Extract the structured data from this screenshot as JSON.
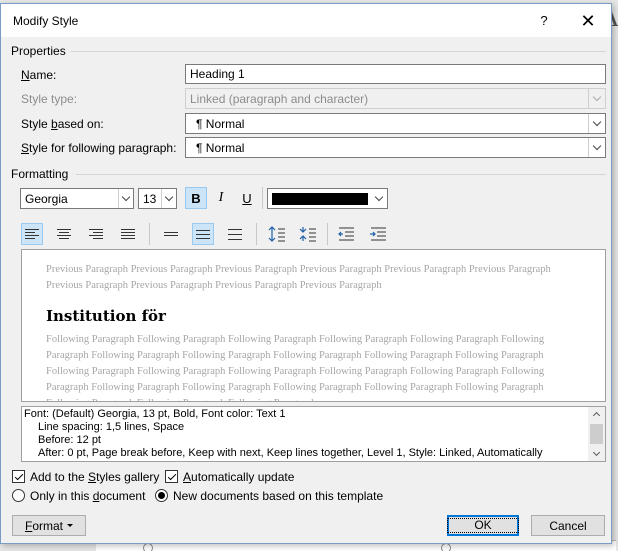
{
  "background": {
    "doc_letter": "A"
  },
  "dialog": {
    "title": "Modify Style",
    "help": "?",
    "close": "✕"
  },
  "properties": {
    "section": "Properties",
    "name_label_pre": "",
    "name_label_u": "N",
    "name_label_post": "ame:",
    "name_value": "Heading 1",
    "style_type_label": "Style type:",
    "style_type_value": "Linked (paragraph and character)",
    "based_on_label_pre": "Style ",
    "based_on_label_u": "b",
    "based_on_label_post": "ased on:",
    "based_on_value": "¶  Normal",
    "following_label_pre": "",
    "following_label_u": "S",
    "following_label_post": "tyle for following paragraph:",
    "following_value": "¶  Normal"
  },
  "formatting": {
    "section": "Formatting",
    "font": "Georgia",
    "size": "13",
    "bold": "B",
    "italic": "I",
    "underline": "U",
    "font_color": "#000000"
  },
  "preview": {
    "previous": "Previous Paragraph Previous Paragraph Previous Paragraph Previous Paragraph Previous Paragraph Previous Paragraph Previous Paragraph Previous Paragraph Previous Paragraph Previous Paragraph",
    "heading": "Institution för",
    "following": "Following Paragraph Following Paragraph Following Paragraph Following Paragraph Following Paragraph Following Paragraph Following Paragraph Following Paragraph Following Paragraph Following Paragraph Following Paragraph Following Paragraph Following Paragraph Following Paragraph Following Paragraph Following Paragraph Following Paragraph Following Paragraph Following Paragraph Following Paragraph Following Paragraph Following Paragraph Following Paragraph Following Paragraph Following Paragraph"
  },
  "description": {
    "line1": "Font: (Default) Georgia, 13 pt, Bold, Font color: Text 1",
    "line2": "Line spacing:  1,5 lines, Space",
    "line3": "Before:  12 pt",
    "line4": "After:  0 pt, Page break before, Keep with next, Keep lines together, Level 1, Style: Linked, Automatically"
  },
  "options": {
    "add_gallery_pre": "Add to the ",
    "add_gallery_u": "S",
    "add_gallery_post": "tyles gallery",
    "add_gallery_checked": true,
    "auto_update_u": "A",
    "auto_update_post": "utomatically update",
    "auto_update_checked": true,
    "only_doc_pre": "Only in this ",
    "only_doc_u": "d",
    "only_doc_post": "ocument",
    "new_docs": "New documents based on this template"
  },
  "buttons": {
    "format_u": "F",
    "format_post": "ormat",
    "ok": "OK",
    "cancel": "Cancel"
  }
}
